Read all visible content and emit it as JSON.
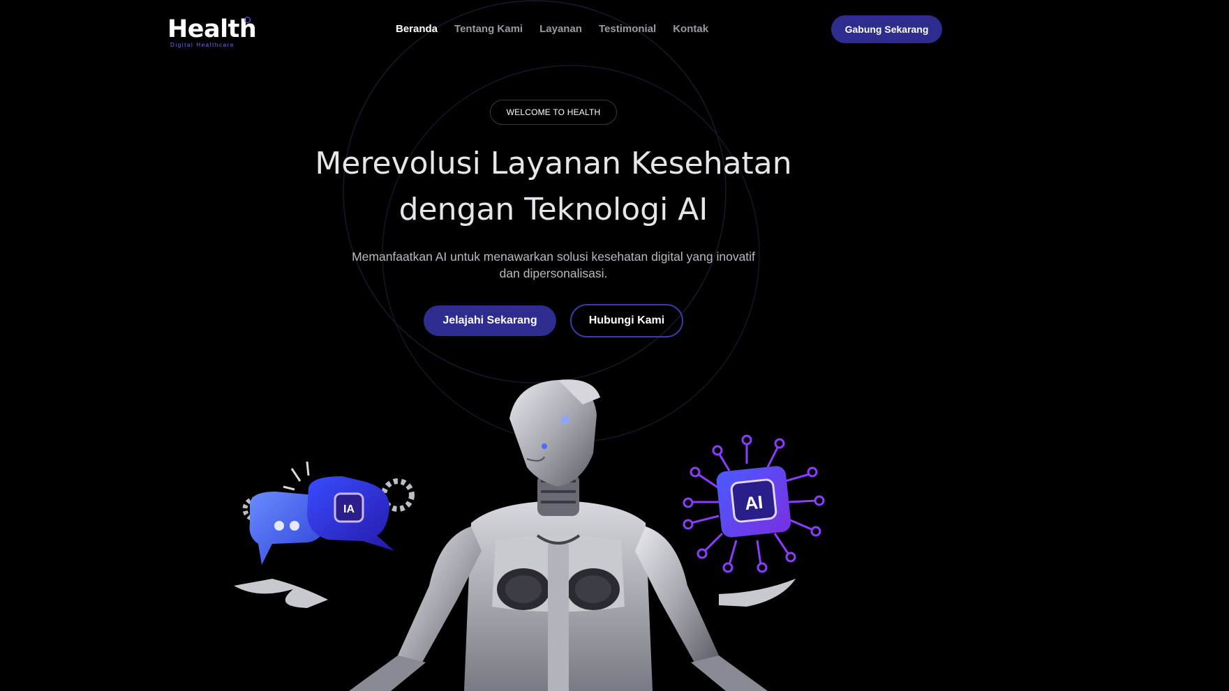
{
  "brand": {
    "name": "Health",
    "tagline": "Digital Healthcare",
    "accent": "#2e2c8e",
    "accent_light": "#6f6fff"
  },
  "nav": {
    "items": [
      {
        "label": "Beranda",
        "active": true
      },
      {
        "label": "Tentang Kami",
        "active": false
      },
      {
        "label": "Layanan",
        "active": false
      },
      {
        "label": "Testimonial",
        "active": false
      },
      {
        "label": "Kontak",
        "active": false
      }
    ],
    "cta": "Gabung Sekarang"
  },
  "hero": {
    "badge": "WELCOME TO HEALTH",
    "title_line1": "Merevolusi Layanan Kesehatan",
    "title_line2": "dengan Teknologi AI",
    "subtitle": "Memanfaatkan AI untuk menawarkan solusi kesehatan digital yang inovatif dan dipersonalisasi.",
    "primary_button": "Jelajahi Sekarang",
    "secondary_button": "Hubungi Kami"
  },
  "illustration": {
    "left_icon": "chat-bubbles-icon",
    "left_chip_label": "IA",
    "right_icon": "ai-chip-icon",
    "right_chip_label": "AI",
    "figure": "robot-illustration"
  }
}
